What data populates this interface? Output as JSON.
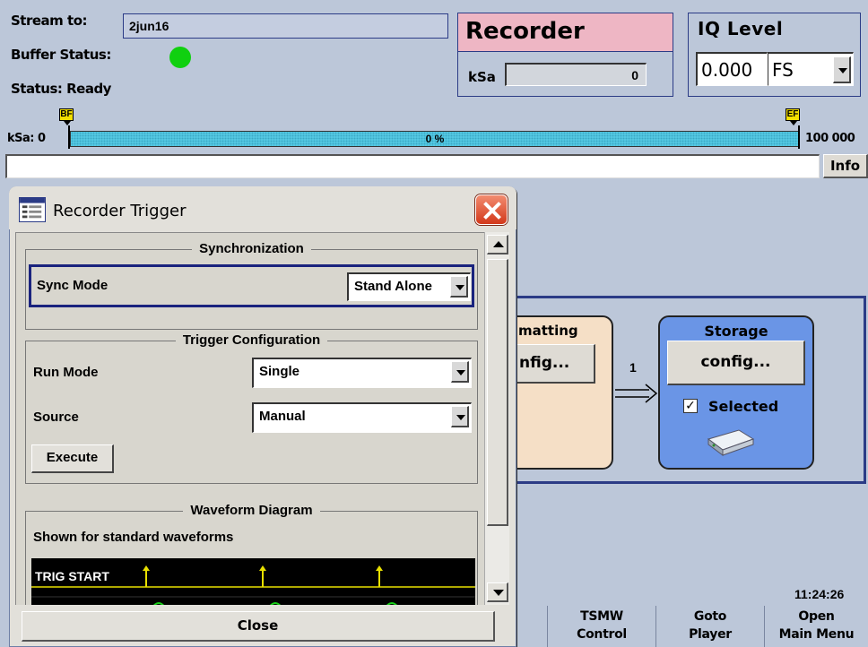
{
  "header": {
    "stream_label": "Stream to:",
    "stream_value": "2jun16",
    "buffer_label": "Buffer Status:",
    "buffer_color": "#10d010",
    "status_label": "Status: Ready"
  },
  "recorder": {
    "title": "Recorder",
    "ksa_label": "kSa",
    "ksa_value": "0"
  },
  "iq_level": {
    "title": "IQ Level",
    "value": "0.000",
    "unit": "FS"
  },
  "progress": {
    "begin_marker": "BF",
    "end_marker": "EF",
    "start_label": "kSa: 0",
    "percent_label": "0 %",
    "percent": 0,
    "end_label": "100 000"
  },
  "info_button": "Info",
  "dialog": {
    "title": "Recorder Trigger",
    "synchronization": {
      "title": "Synchronization",
      "sync_mode_label": "Sync Mode",
      "sync_mode_value": "Stand Alone"
    },
    "trigger_config": {
      "title": "Trigger Configuration",
      "run_mode_label": "Run Mode",
      "run_mode_value": "Single",
      "source_label": "Source",
      "source_value": "Manual",
      "execute_label": "Execute"
    },
    "waveform": {
      "title": "Waveform Diagram",
      "subtitle": "Shown for standard waveforms",
      "trig_label": "TRIG START"
    },
    "close_label": "Close"
  },
  "workspace": {
    "formatting_title": "matting",
    "formatting_button": "nfig...",
    "connection_number": "1",
    "storage_title": "Storage",
    "storage_button": "config...",
    "storage_selected": "Selected",
    "storage_selected_checked": true
  },
  "clock": "11:24:26",
  "softkeys": [
    {
      "line1": "TSMW",
      "line2": "Control"
    },
    {
      "line1": "Goto",
      "line2": "Player"
    },
    {
      "line1": "Open",
      "line2": "Main Menu"
    }
  ]
}
